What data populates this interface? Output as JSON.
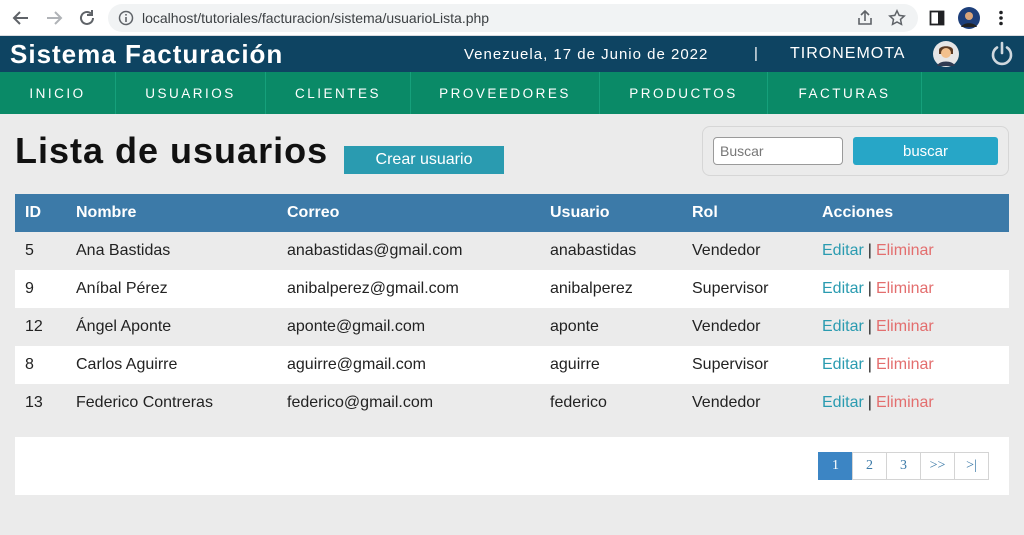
{
  "browser": {
    "url": "localhost/tutoriales/facturacion/sistema/usuarioLista.php"
  },
  "header": {
    "title": "Sistema Facturación",
    "date": "Venezuela, 17 de Junio de 2022",
    "separator": "|",
    "user": "TIRONEMOTA"
  },
  "menu": {
    "items": [
      {
        "label": "INICIO"
      },
      {
        "label": "USUARIOS"
      },
      {
        "label": "CLIENTES"
      },
      {
        "label": "PROVEEDORES"
      },
      {
        "label": "PRODUCTOS"
      },
      {
        "label": "FACTURAS"
      }
    ]
  },
  "main": {
    "title": "Lista de usuarios",
    "create_label": "Crear usuario",
    "search_placeholder": "Buscar",
    "search_button": "buscar"
  },
  "table": {
    "headers": [
      "ID",
      "Nombre",
      "Correo",
      "Usuario",
      "Rol",
      "Acciones"
    ],
    "rows": [
      {
        "id": "5",
        "name": "Ana Bastidas",
        "email": "anabastidas@gmail.com",
        "user": "anabastidas",
        "role": "Vendedor"
      },
      {
        "id": "9",
        "name": "Aníbal Pérez",
        "email": "anibalperez@gmail.com",
        "user": "anibalperez",
        "role": "Supervisor"
      },
      {
        "id": "12",
        "name": "Ángel Aponte",
        "email": "aponte@gmail.com",
        "user": "aponte",
        "role": "Vendedor"
      },
      {
        "id": "8",
        "name": "Carlos Aguirre",
        "email": "aguirre@gmail.com",
        "user": "aguirre",
        "role": "Supervisor"
      },
      {
        "id": "13",
        "name": "Federico Contreras",
        "email": "federico@gmail.com",
        "user": "federico",
        "role": "Vendedor"
      }
    ],
    "edit_label": "Editar",
    "delete_label": "Eliminar",
    "action_separator": "|"
  },
  "pagination": {
    "pages": [
      "1",
      "2",
      "3",
      ">>",
      ">|"
    ],
    "active": "1"
  },
  "colors": {
    "header_bg": "#0e4462",
    "menu_bg": "#0a8a67",
    "table_header_bg": "#3c7aa8",
    "create_button": "#2a9bb0",
    "search_button": "#27a6c7",
    "edit_link": "#2a9bb0",
    "delete_link": "#e36e6e"
  }
}
